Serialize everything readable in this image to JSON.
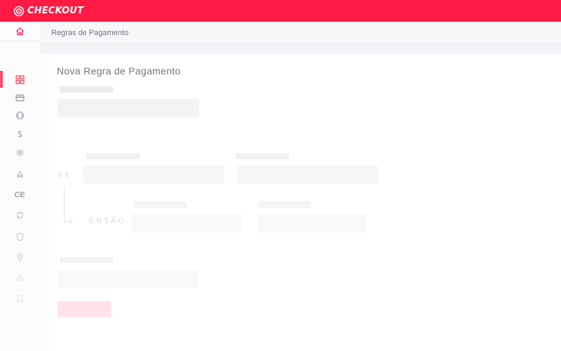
{
  "app": {
    "brand": "CHECKOUT",
    "brand_color": "#ff1a44",
    "logo_icon": "target-circle-icon"
  },
  "sidebar": {
    "home_icon": "home-icon",
    "items": [
      {
        "icon": "dashboard-grid-icon",
        "active": true
      },
      {
        "icon": "credit-card-icon",
        "active": false
      },
      {
        "icon": "carousel-icon",
        "active": false
      },
      {
        "icon": "dollar-icon",
        "active": false
      },
      {
        "icon": "gear-icon",
        "active": false
      },
      {
        "icon": "shipping-icon",
        "active": false
      },
      {
        "icon": "ce-text-icon",
        "label": "CE",
        "active": false
      },
      {
        "icon": "refresh-icon",
        "active": false
      },
      {
        "icon": "shield-icon",
        "active": false
      },
      {
        "icon": "location-pin-icon",
        "active": false
      },
      {
        "icon": "bar-chart-icon",
        "active": false
      },
      {
        "icon": "document-icon",
        "active": false
      }
    ]
  },
  "breadcrumb": {
    "current": "Regras de Pagamento"
  },
  "form": {
    "title": "Nova Regra de Pagamento",
    "if_label": "SE",
    "then_label": "ENTÃO"
  }
}
